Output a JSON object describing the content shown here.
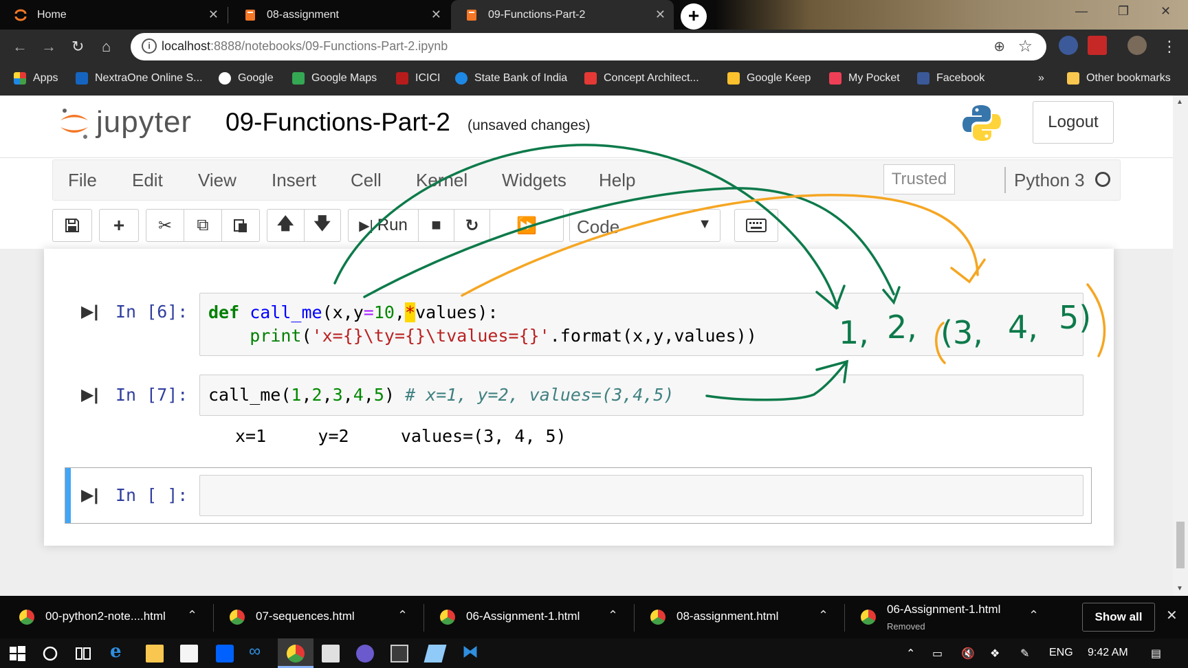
{
  "browser": {
    "tabs": [
      {
        "label": "Home",
        "active": false
      },
      {
        "label": "08-assignment",
        "active": false
      },
      {
        "label": "09-Functions-Part-2",
        "active": true
      }
    ],
    "url_host": "localhost",
    "url_rest": ":8888/notebooks/09-Functions-Part-2.ipynb",
    "bookmarks": [
      "Apps",
      "NextraOne Online S...",
      "Google",
      "Google Maps",
      "ICICI",
      "State Bank of India",
      "Concept Architect...",
      "Google Keep",
      "My Pocket",
      "Facebook"
    ],
    "bookmarks_more": "»",
    "other_bookmarks": "Other bookmarks"
  },
  "jupyter": {
    "logo_text": "jupyter",
    "notebook_title": "09-Functions-Part-2",
    "save_status": "(unsaved changes)",
    "logout_label": "Logout",
    "menu": [
      "File",
      "Edit",
      "View",
      "Insert",
      "Cell",
      "Kernel",
      "Widgets",
      "Help"
    ],
    "trusted_label": "Trusted",
    "kernel_name": "Python 3",
    "toolbar": {
      "run_label": "Run",
      "cell_type": "Code"
    },
    "cells": [
      {
        "prompt": "In [6]:",
        "code_line1": {
          "kw": "def",
          "name": "call_me",
          "params_a": "(x,y",
          "eq": "=",
          "default": "10",
          "comma": ",",
          "star": "*",
          "params_b": "values):"
        },
        "code_line2": {
          "builtin": "print",
          "open": "(",
          "string": "'x={}\\ty={}\\tvalues={}'",
          "rest": ".format(x,y,values))"
        }
      },
      {
        "prompt": "In [7]:",
        "code": {
          "name": "call_me(",
          "args": [
            "1",
            "2",
            "3",
            "4",
            "5"
          ],
          "close": ")",
          "comment": "# x=1, y=2, values=(3,4,5)"
        },
        "output": "x=1\ty=2\tvalues=(3, 4, 5)"
      },
      {
        "prompt": "In [ ]:",
        "code": ""
      }
    ]
  },
  "annotation": {
    "ink_green": "#0d7a4a",
    "ink_orange": "#f5a623",
    "handwritten": [
      "1,",
      "2,",
      "(3,",
      "4,",
      "5)"
    ]
  },
  "downloads": [
    {
      "name": "00-python2-note....html",
      "sub": ""
    },
    {
      "name": "07-sequences.html",
      "sub": ""
    },
    {
      "name": "06-Assignment-1.html",
      "sub": ""
    },
    {
      "name": "08-assignment.html",
      "sub": ""
    },
    {
      "name": "06-Assignment-1.html",
      "sub": "Removed"
    }
  ],
  "downloads_show_all": "Show all",
  "taskbar": {
    "language": "ENG",
    "time": "9:42 AM"
  }
}
